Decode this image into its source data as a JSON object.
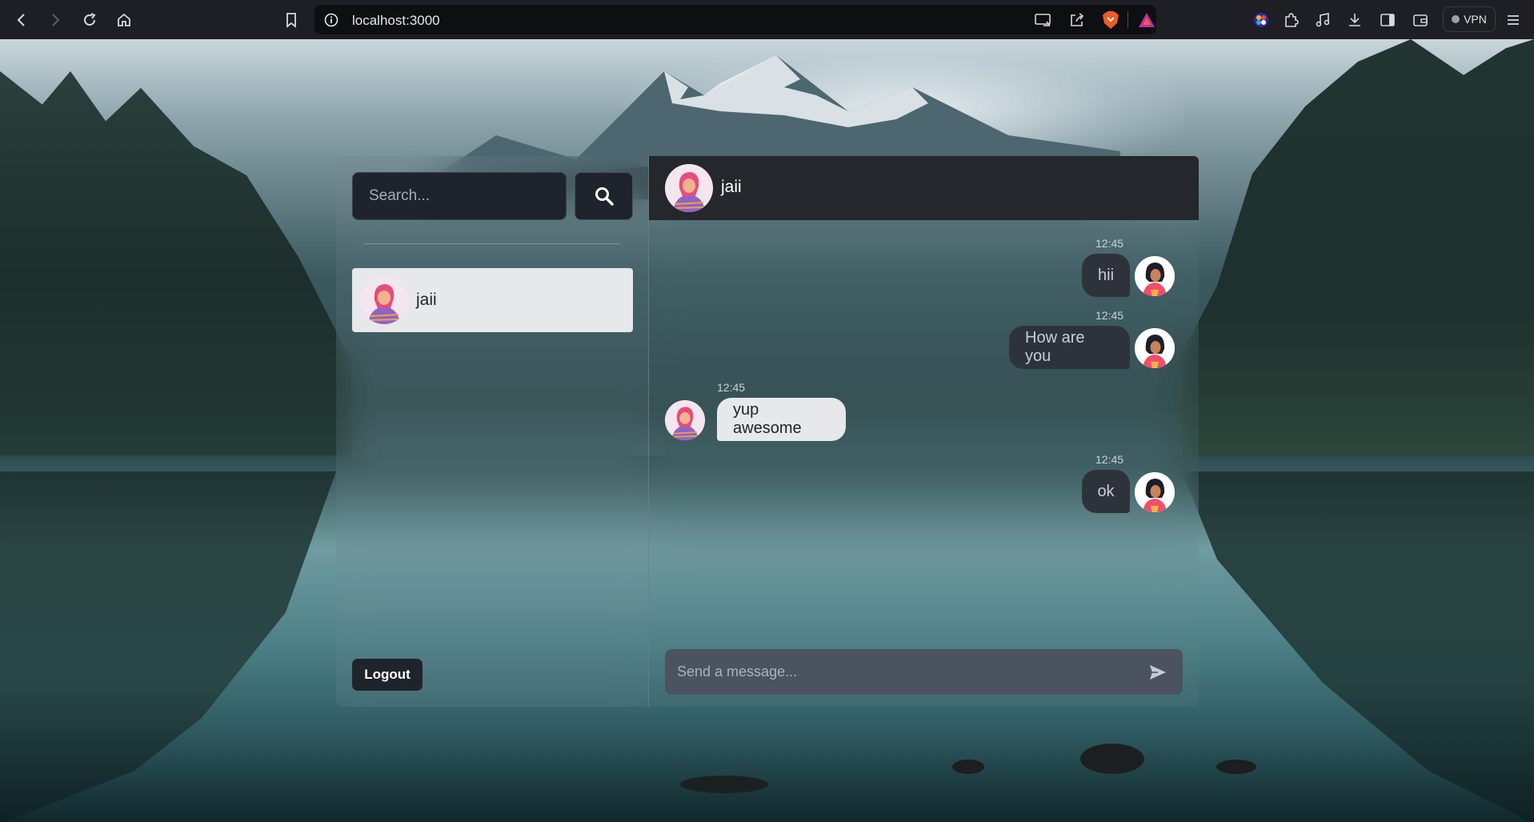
{
  "browser": {
    "url": "localhost:3000",
    "vpn_label": "VPN",
    "icons": [
      "back-icon",
      "forward-icon",
      "reload-icon",
      "home-icon",
      "bookmark-icon",
      "info-icon",
      "cast-icon",
      "share-icon",
      "brave-shield-icon",
      "brave-rewards-icon",
      "wallet-extension-icon",
      "extensions-icon",
      "media-icon",
      "downloads-icon",
      "sidebar-icon",
      "wallet-icon",
      "menu-icon"
    ]
  },
  "sidebar": {
    "search_placeholder": "Search...",
    "conversations": [
      {
        "name": "jaii",
        "avatar": "avatar-pink-hair-icon"
      }
    ],
    "logout_label": "Logout"
  },
  "chat": {
    "header_name": "jaii",
    "messages": [
      {
        "text": "hii",
        "time": "12:45",
        "direction": "outgoing"
      },
      {
        "text": "How are you",
        "time": "12:45",
        "direction": "outgoing"
      },
      {
        "text": "yup awesome",
        "time": "12:45",
        "direction": "incoming"
      },
      {
        "text": "ok",
        "time": "12:45",
        "direction": "outgoing"
      }
    ],
    "composer_placeholder": "Send a message..."
  },
  "colors": {
    "sidebar_item_bg": "#e7e8ea",
    "outgoing_bubble": "#2e333b",
    "incoming_bubble": "#e7e8ea",
    "header_bg": "#24272c",
    "composer_bg": "#4c5360"
  }
}
